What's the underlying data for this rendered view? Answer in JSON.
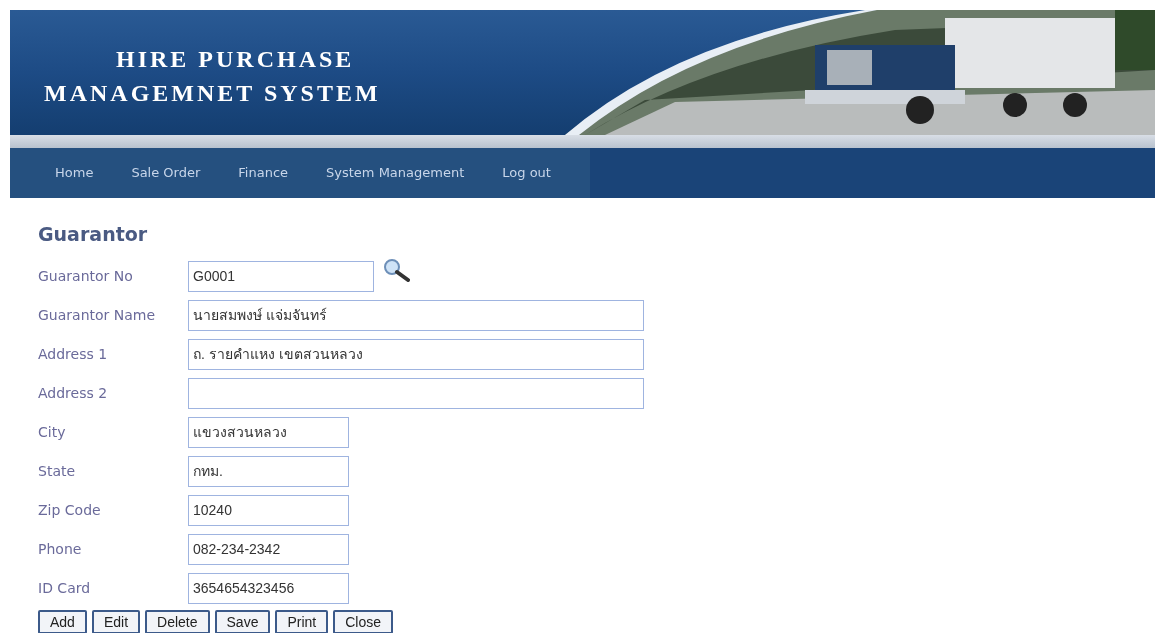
{
  "banner": {
    "title_lines": [
      "HIRE PURCHASE",
      "MANAGEMNET SYSTEM"
    ]
  },
  "nav": {
    "items": [
      {
        "label": "Home"
      },
      {
        "label": "Sale Order"
      },
      {
        "label": "Finance"
      },
      {
        "label": "System Management"
      },
      {
        "label": "Log out"
      }
    ]
  },
  "form": {
    "title": "Guarantor",
    "fields": [
      {
        "label": "Guarantor No",
        "value": "G0001",
        "kind": "lookup"
      },
      {
        "label": "Guarantor Name",
        "value": "นายสมพงษ์ แจ่มจันทร์",
        "kind": "wide"
      },
      {
        "label": "Address 1",
        "value": "ถ. รายคำแหง เขตสวนหลวง",
        "kind": "wide"
      },
      {
        "label": "Address 2",
        "kind": "wide"
      },
      {
        "label": "City",
        "value": "แขวงสวนหลวง",
        "kind": "narrow"
      },
      {
        "label": "State",
        "value": "กทม.",
        "kind": "narrow"
      },
      {
        "label": "Zip Code",
        "value": "10240",
        "kind": "narrow"
      },
      {
        "label": "Phone",
        "value": "082-234-2342",
        "kind": "narrow"
      },
      {
        "label": "ID Card",
        "value": "3654654323456",
        "kind": "narrow"
      }
    ],
    "buttons": [
      "Add",
      "Edit",
      "Delete",
      "Save",
      "Print",
      "Close"
    ]
  }
}
